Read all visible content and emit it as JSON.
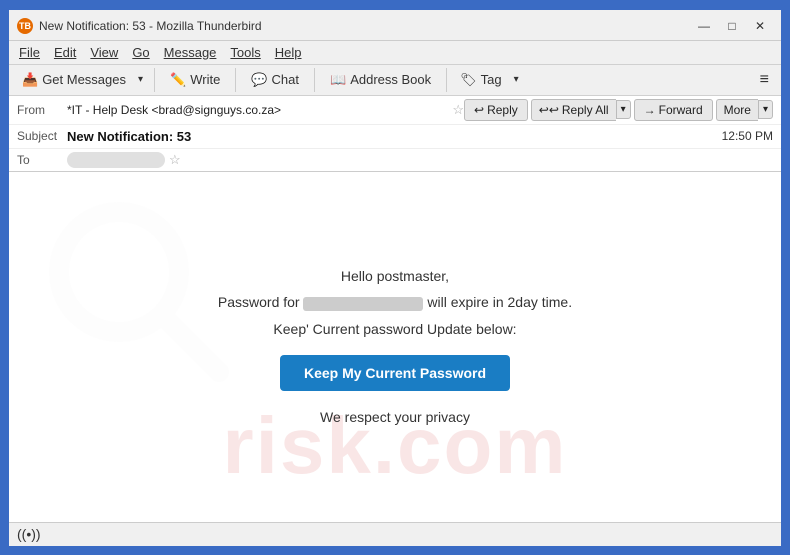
{
  "window": {
    "title": "New Notification: 53 - Mozilla Thunderbird",
    "logo": "TB"
  },
  "window_controls": {
    "minimize": "—",
    "maximize": "□",
    "close": "✕"
  },
  "menu": {
    "items": [
      "File",
      "Edit",
      "View",
      "Go",
      "Message",
      "Tools",
      "Help"
    ]
  },
  "toolbar": {
    "get_messages_label": "Get Messages",
    "write_label": "Write",
    "chat_label": "Chat",
    "address_book_label": "Address Book",
    "tag_label": "Tag",
    "hamburger": "≡"
  },
  "header": {
    "from_label": "From",
    "from_value": "*IT - Help Desk <brad@signguys.co.za>",
    "subject_label": "Subject",
    "subject_value": "New Notification: 53",
    "time": "12:50 PM",
    "to_label": "To",
    "to_value": ""
  },
  "actions": {
    "reply_label": "Reply",
    "reply_all_label": "Reply All",
    "forward_label": "Forward",
    "more_label": "More"
  },
  "email_body": {
    "greeting": "Hello postmaster,",
    "line1_prefix": "Password for",
    "line1_suffix": "will expire in 2day time.",
    "line2": "Keep' Current password Update below:",
    "cta_button": "Keep My Current Password",
    "footer": "We respect your privacy"
  },
  "watermark": {
    "text": "risk.com"
  },
  "status_bar": {
    "wifi_icon": "((•))"
  }
}
